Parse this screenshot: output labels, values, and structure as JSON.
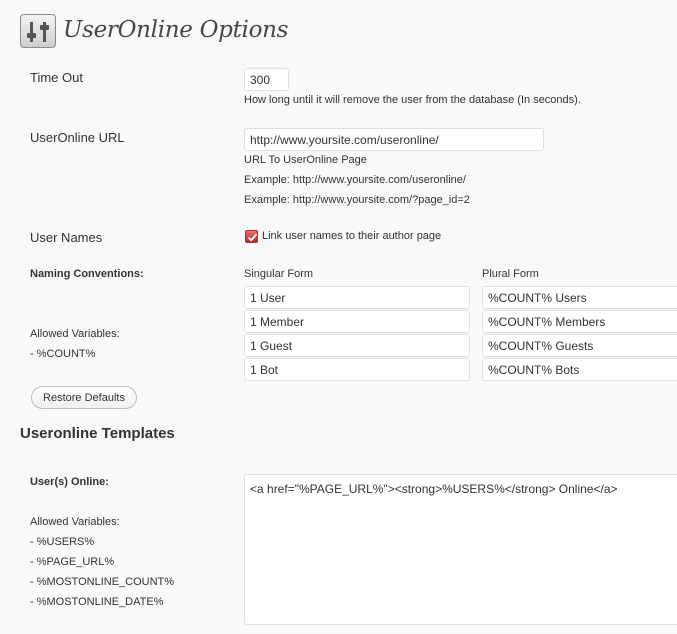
{
  "header": {
    "title": "UserOnline Options",
    "icon": "settings-sliders-icon"
  },
  "timeout": {
    "label": "Time Out",
    "value": "300",
    "help": "How long until it will remove the user from the database (In seconds)."
  },
  "url": {
    "label": "UserOnline URL",
    "value": "http://www.yoursite.com/useronline/",
    "help1": "URL To UserOnline Page",
    "help2": "Example: http://www.yoursite.com/useronline/",
    "help3": "Example: http://www.yoursite.com/?page_id=2"
  },
  "user_names": {
    "label": "User Names",
    "checkbox_label": "Link user names to their author page",
    "checked": true
  },
  "naming": {
    "label": "Naming Conventions:",
    "singular_header": "Singular Form",
    "plural_header": "Plural Form",
    "allowed_label": "Allowed Variables:",
    "allowed_var": "- %COUNT%",
    "rows": [
      {
        "singular": "1 User",
        "plural": "%COUNT% Users"
      },
      {
        "singular": "1 Member",
        "plural": "%COUNT% Members"
      },
      {
        "singular": "1 Guest",
        "plural": "%COUNT% Guests"
      },
      {
        "singular": "1 Bot",
        "plural": "%COUNT% Bots"
      }
    ],
    "restore_label": "Restore Defaults"
  },
  "templates": {
    "heading": "Useronline Templates",
    "users_online_label": "User(s) Online:",
    "allowed_label": "Allowed Variables:",
    "vars": [
      "- %USERS%",
      "- %PAGE_URL%",
      "- %MOSTONLINE_COUNT%",
      "- %MOSTONLINE_DATE%"
    ],
    "template_value": "<a href=\"%PAGE_URL%\"><strong>%USERS%</strong> Online</a>"
  },
  "colors": {
    "checkbox": "#c0392b",
    "background": "#f9f9f9"
  }
}
